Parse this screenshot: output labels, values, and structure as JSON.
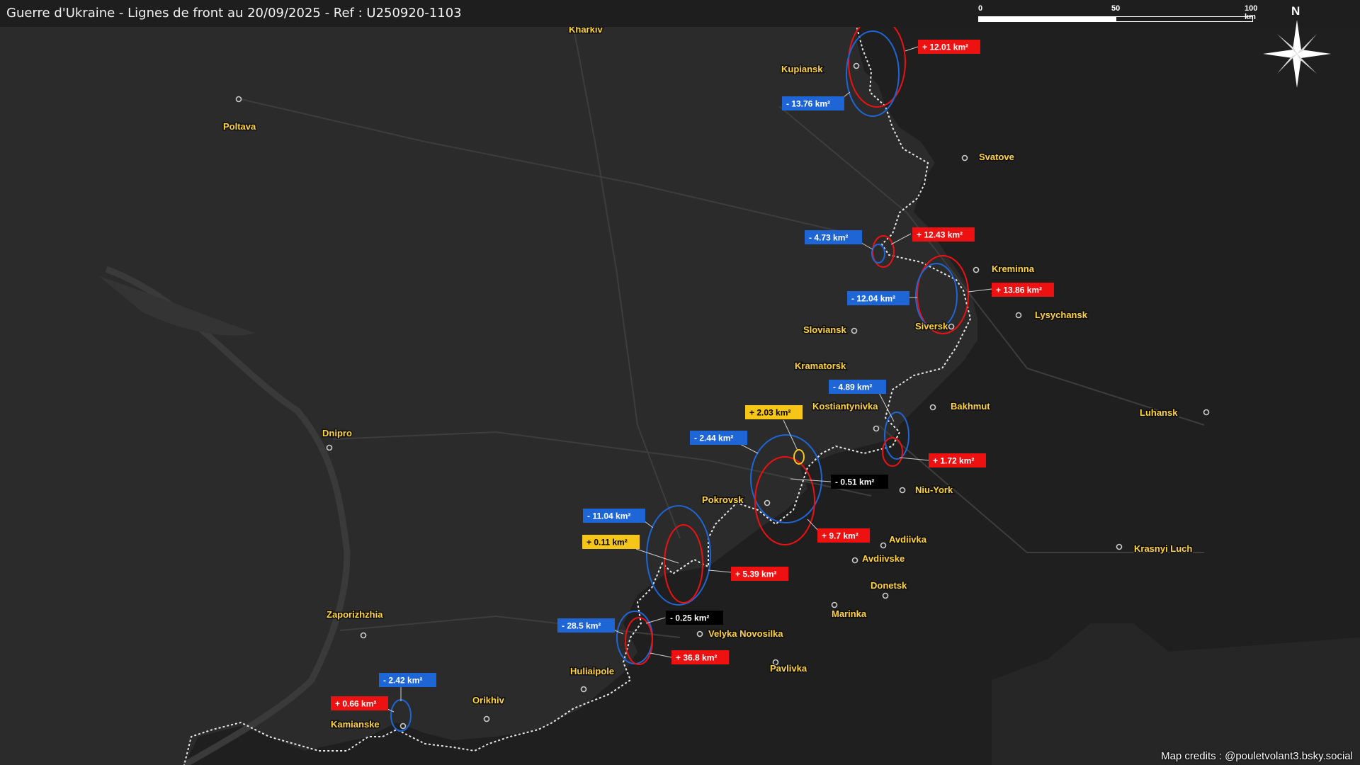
{
  "header": {
    "title": "Guerre d'Ukraine - Lignes de front au 20/09/2025 - Ref : U250920-1103"
  },
  "scale": {
    "ticks": [
      "0",
      "50",
      "100 km"
    ]
  },
  "north_label": "N",
  "credits": "Map credits : @pouletvolant3.bsky.social",
  "colors": {
    "gain": "#ee1111",
    "loss": "#1e66d6",
    "small_gain": "#f5c518",
    "neutral": "#000000",
    "city_label": "#ffd23f",
    "frontline": "#e8e8e8"
  },
  "cities": [
    {
      "name": "Kharkiv"
    },
    {
      "name": "Kupiansk"
    },
    {
      "name": "Poltava"
    },
    {
      "name": "Svatove"
    },
    {
      "name": "Kreminna"
    },
    {
      "name": "Lysychansk"
    },
    {
      "name": "Siversk"
    },
    {
      "name": "Sloviansk"
    },
    {
      "name": "Kramatorsk"
    },
    {
      "name": "Kostiantynivka"
    },
    {
      "name": "Bakhmut"
    },
    {
      "name": "Luhansk"
    },
    {
      "name": "Dnipro"
    },
    {
      "name": "Pokrovsk"
    },
    {
      "name": "Niu-York"
    },
    {
      "name": "Avdiivka"
    },
    {
      "name": "Avdiivske"
    },
    {
      "name": "Donetsk"
    },
    {
      "name": "Krasnyi Luch"
    },
    {
      "name": "Marinka"
    },
    {
      "name": "Velyka Novosilka"
    },
    {
      "name": "Zaporizhzhia"
    },
    {
      "name": "Huliaipole"
    },
    {
      "name": "Pavlivka"
    },
    {
      "name": "Orikhiv"
    },
    {
      "name": "Kamianske"
    }
  ],
  "area_changes": [
    {
      "label": "+ 12.01 km²",
      "kind": "gain"
    },
    {
      "label": "- 13.76 km²",
      "kind": "loss"
    },
    {
      "label": "- 4.73 km²",
      "kind": "loss"
    },
    {
      "label": "+ 12.43 km²",
      "kind": "gain"
    },
    {
      "label": "+ 13.86 km²",
      "kind": "gain"
    },
    {
      "label": "- 12.04 km²",
      "kind": "loss"
    },
    {
      "label": "- 4.89 km²",
      "kind": "loss"
    },
    {
      "label": "+ 1.72 km²",
      "kind": "gain"
    },
    {
      "label": "+ 2.03 km²",
      "kind": "small_gain"
    },
    {
      "label": "- 2.44 km²",
      "kind": "loss"
    },
    {
      "label": "- 0.51 km²",
      "kind": "neutral"
    },
    {
      "label": "+ 9.7 km²",
      "kind": "gain"
    },
    {
      "label": "- 11.04 km²",
      "kind": "loss"
    },
    {
      "label": "+ 0.11 km²",
      "kind": "small_gain"
    },
    {
      "label": "+ 5.39 km²",
      "kind": "gain"
    },
    {
      "label": "- 28.5 km²",
      "kind": "loss"
    },
    {
      "label": "- 0.25 km²",
      "kind": "neutral"
    },
    {
      "label": "+ 36.8 km²",
      "kind": "gain"
    },
    {
      "label": "- 2.42 km²",
      "kind": "loss"
    },
    {
      "label": "+ 0.66 km²",
      "kind": "gain"
    }
  ]
}
